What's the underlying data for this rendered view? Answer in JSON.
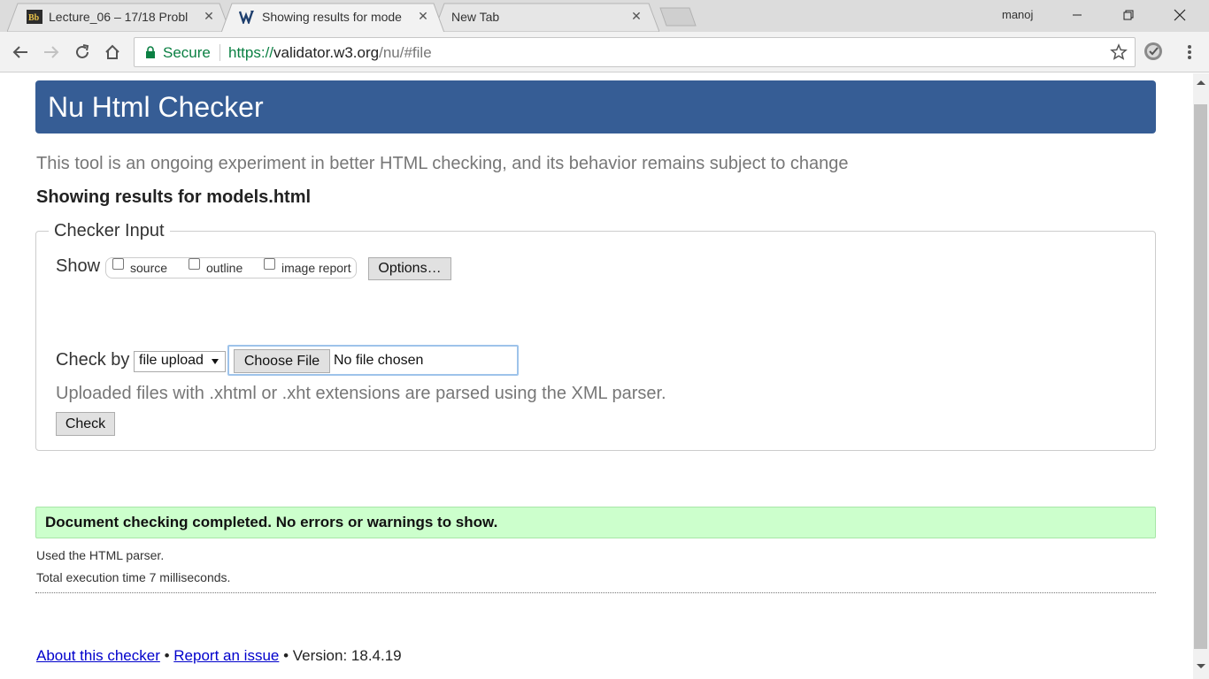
{
  "browser": {
    "tabs": [
      {
        "title": "Lecture_06 – 17/18 Probl",
        "favicon": "blackboard-bb-icon",
        "active": false
      },
      {
        "title": "Showing results for mode",
        "favicon": "w3c-nu-icon",
        "active": true
      },
      {
        "title": "New Tab",
        "favicon": "",
        "active": false
      }
    ],
    "profile_name": "manoj",
    "omnibox": {
      "secure_label": "Secure",
      "url_scheme": "https://",
      "url_host": "validator.w3.org",
      "url_path": "/nu/#file"
    }
  },
  "page": {
    "banner_title": "Nu Html Checker",
    "subtitle": "This tool is an ongoing experiment in better HTML checking, and its behavior remains subject to change",
    "results_heading": "Showing results for models.html",
    "checker_input": {
      "legend": "Checker Input",
      "show_label": "Show",
      "checkboxes": [
        {
          "label": "source",
          "checked": false
        },
        {
          "label": "outline",
          "checked": false
        },
        {
          "label": "image report",
          "checked": false
        }
      ],
      "options_button": "Options…",
      "check_by_label": "Check by",
      "check_by_selected": "file upload",
      "choose_file_button": "Choose File",
      "no_file_text": "No file chosen",
      "upload_note": "Uploaded files with .xhtml or .xht extensions are parsed using the XML parser.",
      "check_button": "Check"
    },
    "status": {
      "success_message": "Document checking completed. No errors or warnings to show.",
      "parser_used": "Used the HTML parser.",
      "execution_time": "Total execution time 7 milliseconds."
    },
    "footer": {
      "about_link": "About this checker",
      "bullet": "•",
      "report_link": "Report an issue",
      "version_text": "• Version: 18.4.19"
    }
  },
  "colors": {
    "banner_bg": "#365d95",
    "success_bg": "#ccffcc",
    "secure_green": "#0b8043",
    "link_blue": "#0000cc"
  }
}
